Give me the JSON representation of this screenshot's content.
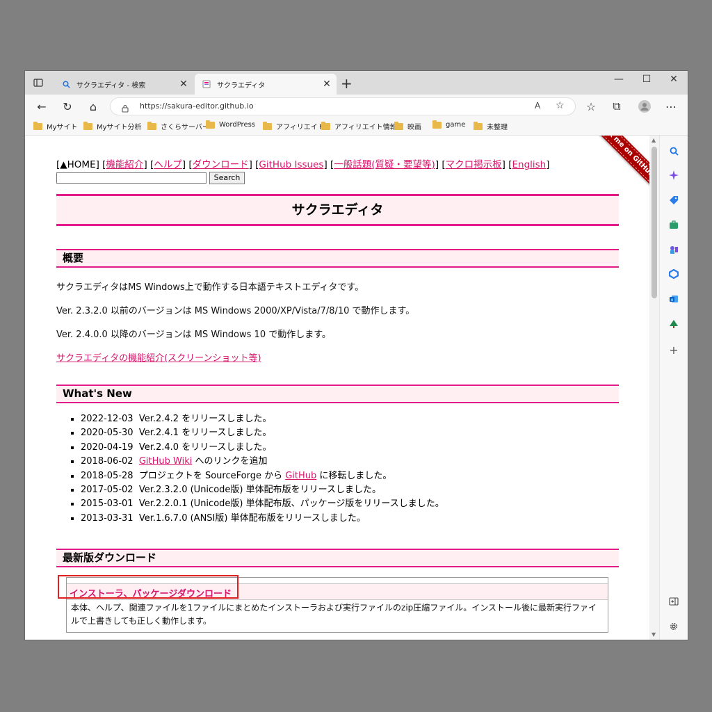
{
  "browser": {
    "tabs": [
      {
        "label": "サクラエディタ - 検索",
        "close": "✕"
      },
      {
        "label": "サクラエディタ",
        "close": "✕"
      }
    ],
    "new_tab": "+",
    "window_controls": {
      "minimize": "—",
      "maximize": "☐",
      "close": "✕"
    },
    "nav": {
      "back": "←",
      "refresh": "↻",
      "home": "⌂"
    },
    "url": "https://sakura-editor.github.io",
    "url_actions": {
      "read_aloud": "A",
      "favorite": "☆",
      "favorites": "☆",
      "collections": "⧉",
      "more": "⋯"
    },
    "bookmarks": [
      "Myサイト",
      "Myサイト分析",
      "さくらサーバー",
      "WordPress",
      "アフィリエイト",
      "アフィリエイト情報",
      "映画",
      "game",
      "未整理"
    ],
    "sidebar_add": "+"
  },
  "page": {
    "topnav": {
      "home": "[▲HOME]",
      "links": [
        "機能紹介",
        "ヘルプ",
        "ダウンロード",
        "GitHub Issues",
        "一般話題(質疑・要望等)",
        "マクロ掲示板",
        "English"
      ]
    },
    "search_button": "Search",
    "title": "サクラエディタ",
    "ribbon": "Fork me on GitHub",
    "overview": {
      "heading": "概要",
      "p1": "サクラエディタはMS Windows上で動作する日本語テキストエディタです。",
      "p2": "Ver. 2.3.2.0 以前のバージョンは MS Windows 2000/XP/Vista/7/8/10 で動作します。",
      "p3": "Ver. 2.4.0.0 以降のバージョンは MS Windows 10 で動作します。",
      "link": "サクラエディタの機能紹介(スクリーンショット等)"
    },
    "whats_new": {
      "heading": "What's New",
      "items": [
        {
          "date": "2022-12-03",
          "pre": "Ver.2.4.2 をリリースしました。"
        },
        {
          "date": "2020-05-30",
          "pre": "Ver.2.4.1 をリリースしました。"
        },
        {
          "date": "2020-04-19",
          "pre": "Ver.2.4.0 をリリースしました。"
        },
        {
          "date": "2018-06-02",
          "link": "GitHub Wiki",
          "post": "へのリンクを追加"
        },
        {
          "date": "2018-05-28",
          "pre": "プロジェクトを SourceForge から",
          "link": "GitHub",
          "post": "に移転しました。"
        },
        {
          "date": "2017-05-02",
          "pre": "Ver.2.3.2.0 (Unicode版) 単体配布版をリリースしました。"
        },
        {
          "date": "2015-03-01",
          "pre": "Ver.2.2.0.1 (Unicode版) 単体配布版、パッケージ版をリリースしました。"
        },
        {
          "date": "2013-03-31",
          "pre": "Ver.1.6.7.0 (ANSI版) 単体配布版をリリースしました。"
        }
      ]
    },
    "download": {
      "heading": "最新版ダウンロード",
      "link": "インストーラ、パッケージダウンロード",
      "desc": "本体、ヘルプ、関連ファイルを1ファイルにまとめたインストーラおよび実行ファイルのzip圧縮ファイル。インストール後に最新実行ファイルで上書きしても正しく動作します。"
    }
  },
  "colors": {
    "accent": "#e4198a",
    "link": "#d6146b",
    "heading_bg": "#ffeef2",
    "highlight": "#e02020",
    "ribbon": "#aa0000"
  }
}
